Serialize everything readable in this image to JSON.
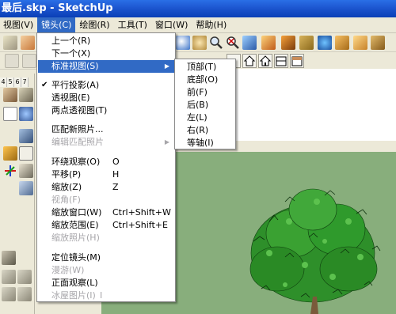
{
  "window": {
    "title": "最后.skp - SketchUp"
  },
  "menubar": {
    "items": [
      {
        "label": "视图(V)",
        "active": false
      },
      {
        "label": "镜头(C)",
        "active": true
      },
      {
        "label": "绘图(R)",
        "active": false
      },
      {
        "label": "工具(T)",
        "active": false
      },
      {
        "label": "窗口(W)",
        "active": false
      },
      {
        "label": "帮助(H)",
        "active": false
      }
    ]
  },
  "layer_numbers": [
    "4",
    "5",
    "6",
    "7"
  ],
  "camera_menu": {
    "items": [
      {
        "label": "上一个(R)",
        "shortcut": "",
        "disabled": false
      },
      {
        "label": "下一个(X)",
        "shortcut": "",
        "disabled": false
      },
      {
        "label": "标准视图(S)",
        "shortcut": "",
        "disabled": false,
        "submenu": true,
        "highlighted": true
      },
      {
        "label": "平行投影(A)",
        "shortcut": "",
        "disabled": false,
        "checked": true
      },
      {
        "label": "透视图(E)",
        "shortcut": "",
        "disabled": false
      },
      {
        "label": "两点透视图(T)",
        "shortcut": "",
        "disabled": false
      },
      {
        "label": "匹配新照片...",
        "shortcut": "",
        "disabled": false
      },
      {
        "label": "编辑匹配照片",
        "shortcut": "",
        "disabled": true,
        "submenu": true
      },
      {
        "label": "环绕观察(O)",
        "shortcut": "O",
        "disabled": false
      },
      {
        "label": "平移(P)",
        "shortcut": "H",
        "disabled": false
      },
      {
        "label": "缩放(Z)",
        "shortcut": "Z",
        "disabled": false
      },
      {
        "label": "视角(F)",
        "shortcut": "",
        "disabled": true
      },
      {
        "label": "缩放窗口(W)",
        "shortcut": "Ctrl+Shift+W",
        "disabled": false
      },
      {
        "label": "缩放范围(E)",
        "shortcut": "Ctrl+Shift+E",
        "disabled": false
      },
      {
        "label": "缩放照片(H)",
        "shortcut": "",
        "disabled": true
      },
      {
        "label": "定位镜头(M)",
        "shortcut": "",
        "disabled": false
      },
      {
        "label": "漫游(W)",
        "shortcut": "",
        "disabled": true
      },
      {
        "label": "正面观察(L)",
        "shortcut": "",
        "disabled": false
      },
      {
        "label": "冰屋图片(I)",
        "shortcut": "I",
        "disabled": true
      }
    ]
  },
  "standard_views_submenu": {
    "items": [
      "顶部(T)",
      "底部(O)",
      "前(F)",
      "后(B)",
      "左(L)",
      "右(R)",
      "等轴(I)"
    ]
  },
  "colors": {
    "menu_highlight": "#316ac5",
    "title_bar": "#1d56d0",
    "ground": "#88ae7c"
  }
}
